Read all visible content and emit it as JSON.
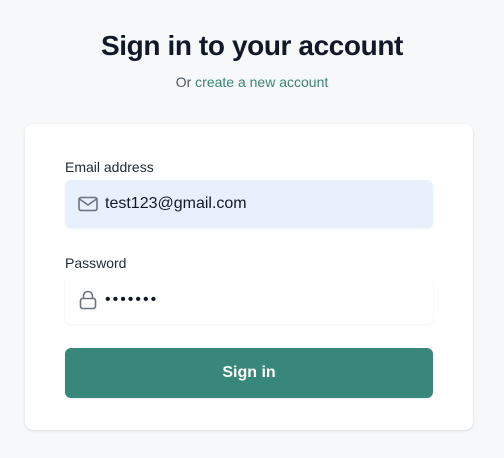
{
  "header": {
    "title": "Sign in to your account",
    "subtitle_prefix": "Or",
    "subtitle_link": "create a new account"
  },
  "form": {
    "email": {
      "label": "Email address",
      "value": "test123@gmail.com",
      "icon": "mail-icon"
    },
    "password": {
      "label": "Password",
      "value": "•••••••",
      "icon": "lock-icon"
    },
    "submit_label": "Sign in"
  },
  "colors": {
    "accent": "#38877a",
    "link": "#3a8476",
    "background": "#f6f8fa",
    "email_field_bg": "#e8effd"
  }
}
